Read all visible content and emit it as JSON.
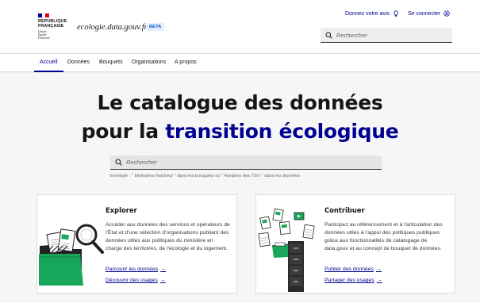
{
  "header": {
    "republic_line1": "RÉPUBLIQUE",
    "republic_line2": "FRANÇAISE",
    "motto_line1": "Liberté",
    "motto_line2": "Égalité",
    "motto_line3": "Fraternité",
    "site_name": "ecologie.data.gouv.fr",
    "badge": "BETA",
    "feedback_link": "Donnez votre avis",
    "login_link": "Se connecter",
    "search_placeholder": "Rechercher"
  },
  "nav": {
    "items": [
      {
        "label": "Accueil",
        "active": true
      },
      {
        "label": "Données",
        "active": false
      },
      {
        "label": "Bouquets",
        "active": false
      },
      {
        "label": "Organisations",
        "active": false
      },
      {
        "label": "A propos",
        "active": false
      }
    ]
  },
  "hero": {
    "title_line1": "Le catalogue des données",
    "title_line2_prefix": "pour la",
    "title_line2_accent": "transition écologique",
    "search_placeholder": "Rechercher",
    "example": "Exemple : \" Itinéraires fraicheur \" dans les bouquets ou \" Horaires des TGV \" dans les données"
  },
  "cards": {
    "explorer": {
      "title": "Explorer",
      "text": "Accéder aux données des services et opérateurs de l'État et d'une sélection d'organisations publiant des données utiles aux politiques du ministère en charge des territoires, de l'écologie et du logement.",
      "link1": "Parcourir les données",
      "link2": "Découvrir des usages"
    },
    "contribuer": {
      "title": "Contribuer",
      "text": "Participez au référencement et à l'articulation des données utiles à l'appui des politiques publiques grâce aux fonctionnalités de catalogage de data.gouv et au concept de bouquet de données.",
      "link1": "Publier des données",
      "link2": "Partager des usages"
    }
  },
  "colors": {
    "primary": "#000091",
    "accent_green": "#18a65a",
    "flag_blue": "#000091",
    "flag_red": "#e1000f"
  },
  "icons": {
    "feedback": "lightbulb-icon",
    "login": "user-icon",
    "search": "search-icon",
    "arrow": "arrow-right-icon"
  }
}
